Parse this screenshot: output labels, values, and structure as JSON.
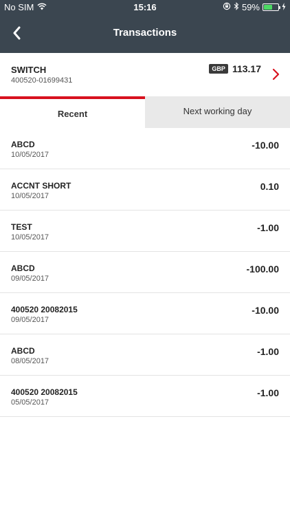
{
  "status_bar": {
    "carrier": "No SIM",
    "time": "15:16",
    "battery_percent": "59%",
    "battery_level": 0.59
  },
  "nav": {
    "title": "Transactions"
  },
  "account": {
    "name": "SWITCH",
    "number": "400520-01699431",
    "currency": "GBP",
    "balance": "113.17"
  },
  "tabs": [
    {
      "label": "Recent",
      "active": true
    },
    {
      "label": "Next working day",
      "active": false
    }
  ],
  "transactions": [
    {
      "description": "ABCD",
      "date": "10/05/2017",
      "amount": "-10.00"
    },
    {
      "description": "ACCNT SHORT",
      "date": "10/05/2017",
      "amount": "0.10"
    },
    {
      "description": "TEST",
      "date": "10/05/2017",
      "amount": "-1.00"
    },
    {
      "description": "ABCD",
      "date": "09/05/2017",
      "amount": "-100.00"
    },
    {
      "description": "400520 20082015",
      "date": "09/05/2017",
      "amount": "-10.00"
    },
    {
      "description": "ABCD",
      "date": "08/05/2017",
      "amount": "-1.00"
    },
    {
      "description": "400520 20082015",
      "date": "05/05/2017",
      "amount": "-1.00"
    }
  ],
  "colors": {
    "header_bg": "#3b4650",
    "accent_red": "#d8121f",
    "battery_green": "#4cd964"
  }
}
